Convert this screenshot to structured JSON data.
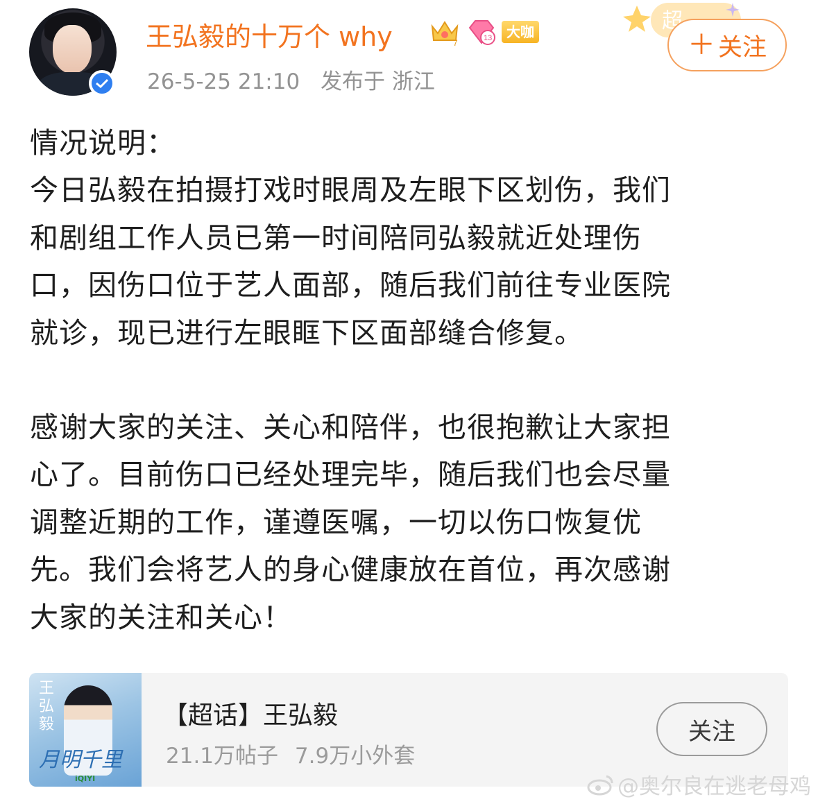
{
  "post": {
    "username": "王弘毅的十万个 why",
    "badge_label": "大咖",
    "badge_level": "13",
    "crown_level": "7",
    "timestamp": "26-5-25 21:10",
    "location": "发布于 浙江",
    "follow_label": "关注",
    "corner_label": "超",
    "paragraphs": [
      [
        "情况说明：",
        "今日弘毅在拍摄打戏时眼周及左眼下区划伤，我们",
        "和剧组工作人员已第一时间陪同弘毅就近处理伤",
        "口，因伤口位于艺人面部，随后我们前往专业医院",
        "就诊，现已进行左眼眶下区面部缝合修复。"
      ],
      [
        "感谢大家的关注、关心和陪伴，也很抱歉让大家担",
        "心了。目前伤口已经处理完毕，随后我们也会尽量",
        "调整近期的工作，谨遵医嘱，一切以伤口恢复优",
        "先。我们会将艺人的身心健康放在首位，再次感谢",
        "大家的关注和关心！"
      ]
    ]
  },
  "topic": {
    "name": "【超话】王弘毅",
    "posts": "21.1万帖子",
    "members": "7.9万小外套",
    "follow_label": "关注",
    "thumb_title": "月明千里",
    "thumb_side": "王弘毅",
    "thumb_logo": "iQIYI"
  },
  "watermark": "@奥尔良在逃老母鸡",
  "colors": {
    "accent_orange": "#f2731f",
    "verified_blue": "#2f7ff0",
    "meta_gray": "#939393"
  }
}
